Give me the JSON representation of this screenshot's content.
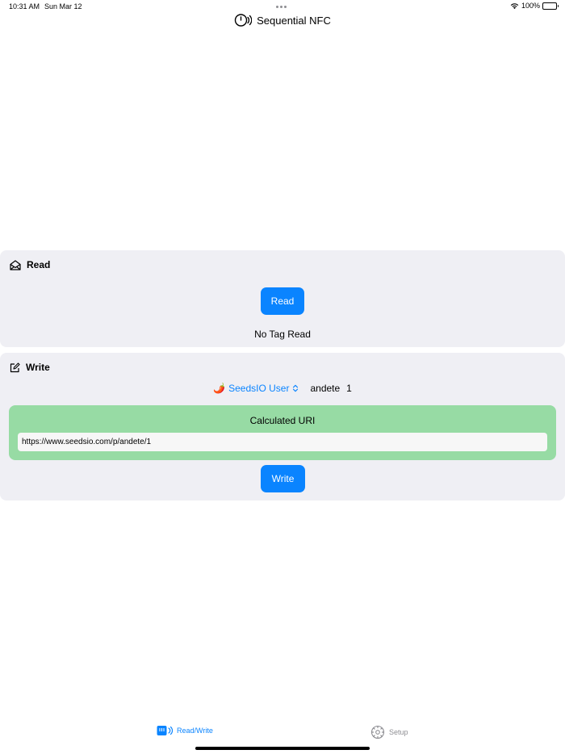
{
  "status_bar": {
    "time": "10:31 AM",
    "date": "Sun Mar 12",
    "battery": "100%"
  },
  "nav": {
    "title": "Sequential NFC"
  },
  "read_section": {
    "header": "Read",
    "button_label": "Read",
    "status": "No Tag Read"
  },
  "write_section": {
    "header": "Write",
    "user_emoji": "🌶️",
    "user_picker_label": "SeedsIO User",
    "user_name": "andete",
    "counter": "1",
    "uri_title": "Calculated URI",
    "uri_value": "https://www.seedsio.com/p/andete/1",
    "button_label": "Write"
  },
  "tabs": [
    {
      "label": "Read/Write",
      "icon": "nfc-read-write-icon",
      "selected": true
    },
    {
      "label": "Setup",
      "icon": "gear-icon",
      "selected": false
    }
  ],
  "colors": {
    "accent": "#0a84ff",
    "card_background": "#efeff4",
    "uri_panel": "#97dba4",
    "inactive_tab": "#8e8e93"
  }
}
